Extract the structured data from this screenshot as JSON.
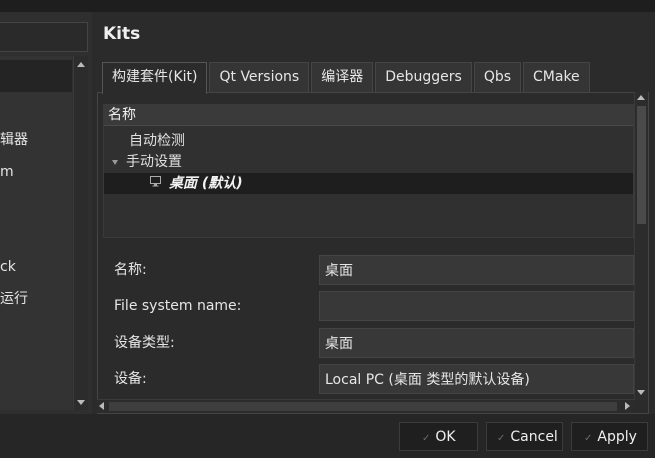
{
  "left_panel": {
    "items": [
      {
        "label": "辑器",
        "top": 0
      },
      {
        "label": "m",
        "top": 0
      },
      {
        "label": "ck",
        "top": 0
      },
      {
        "label": "运行",
        "top": 0
      }
    ]
  },
  "main": {
    "title": "Kits",
    "tabs": [
      {
        "label": "构建套件(Kit)",
        "active": true
      },
      {
        "label": "Qt Versions",
        "active": false
      },
      {
        "label": "编译器",
        "active": false
      },
      {
        "label": "Debuggers",
        "active": false
      },
      {
        "label": "Qbs",
        "active": false
      },
      {
        "label": "CMake",
        "active": false
      }
    ],
    "tree": {
      "header": "名称",
      "auto_detected": "自动检测",
      "manual": "手动设置",
      "selected_kit": "桌面 (默认)"
    },
    "form": {
      "name_label": "名称:",
      "name_value": "桌面",
      "fs_label": "File system name:",
      "fs_value": "",
      "device_type_label": "设备类型:",
      "device_type_value": "桌面",
      "device_label": "设备:",
      "device_value": "Local PC (桌面 类型的默认设备)"
    }
  },
  "buttons": {
    "ok": "OK",
    "cancel": "Cancel",
    "apply": "Apply"
  },
  "icons": {
    "check": "check-icon",
    "monitor": "monitor-icon",
    "expand": "triangle-down-icon"
  }
}
